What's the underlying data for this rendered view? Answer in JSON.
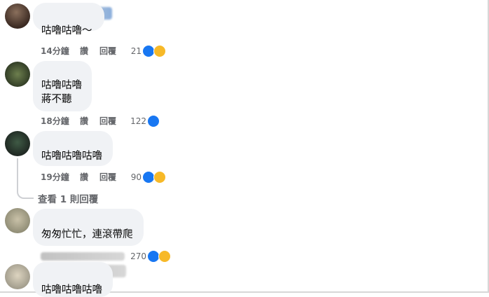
{
  "actions": {
    "like_label": "讚",
    "reply_label": "回覆"
  },
  "comments": [
    {
      "text": "咕嚕咕嚕～",
      "time": "14分鐘",
      "count": "21",
      "reactions": [
        "like-icon",
        "haha-icon"
      ]
    },
    {
      "text": "咕嚕咕嚕\n蔣不聽",
      "time": "18分鐘",
      "count": "122",
      "reactions": [
        "like-icon"
      ]
    },
    {
      "text": "咕嚕咕嚕咕嚕",
      "time": "19分鐘",
      "count": "90",
      "reactions": [
        "like-icon",
        "haha-icon"
      ]
    },
    {
      "text": "匆匆忙忙，連滾帶爬",
      "time": "",
      "count": "270",
      "reactions": [
        "like-icon",
        "haha-icon"
      ]
    },
    {
      "text": "咕嚕咕嚕咕嚕",
      "time": "",
      "count": "",
      "reactions": []
    }
  ],
  "view_replies": "查看 1 則回覆",
  "colors": {
    "bubble": "#f0f2f5",
    "like": "#1877f2",
    "haha": "#f7b928",
    "meta_text": "#65676b"
  }
}
